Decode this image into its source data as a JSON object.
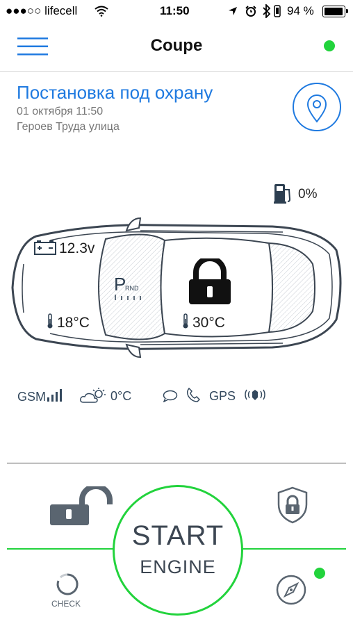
{
  "status_bar": {
    "carrier": "●●●○○ lifecell",
    "time": "11:50",
    "battery": "94 %"
  },
  "header": {
    "title": "Coupe"
  },
  "event": {
    "title": "Постановка под охрану",
    "date": "01 октября 11:50",
    "address": "Героев Труда улица"
  },
  "car": {
    "fuel": "0%",
    "battery_voltage": "12.3v",
    "gear_main": "P",
    "gear_others": "RND",
    "temp_engine": "18°C",
    "temp_cabin": "30°C"
  },
  "indicators": {
    "gsm": "GSM",
    "weather": "0°C",
    "gps": "GPS"
  },
  "controls": {
    "start": "START",
    "engine": "ENGINE",
    "check": "CHECK"
  },
  "colors": {
    "accent_blue": "#1f7ae0",
    "online_green": "#22d33c",
    "icon_dark": "#3c4652"
  }
}
